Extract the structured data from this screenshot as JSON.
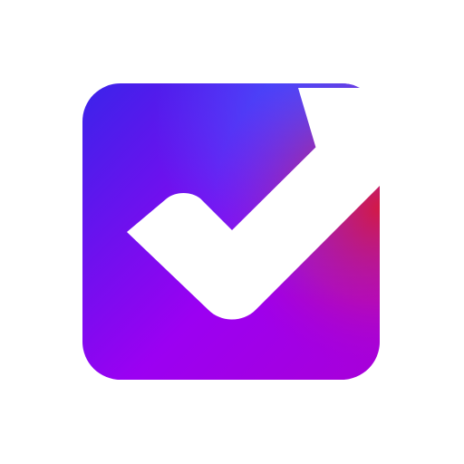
{
  "app_icon": {
    "icon": "checkbox-checkmark-icon",
    "colors": {
      "background": "#ffffff",
      "gradient_blue": "#2f66ff",
      "gradient_indigo": "#3a24ea",
      "gradient_violet": "#9b00f2",
      "gradient_red": "#d21a46",
      "checkmark": "#ffffff"
    }
  }
}
